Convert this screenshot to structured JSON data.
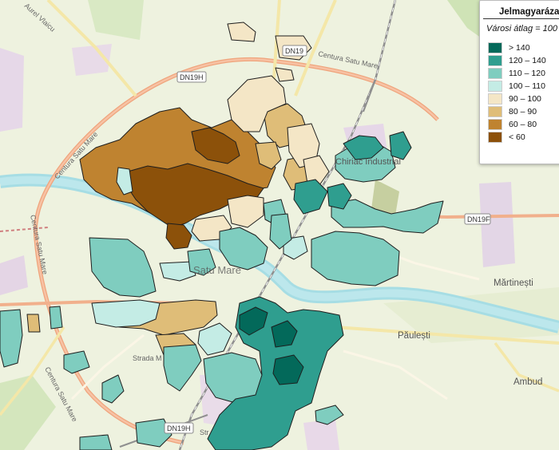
{
  "legend": {
    "title": "Jelmagyarázat",
    "subtitle": "Városi átlag = 100",
    "items": [
      {
        "label": "> 140",
        "color": "#03695a"
      },
      {
        "label": "120 – 140",
        "color": "#2f9e8f"
      },
      {
        "label": "110 – 120",
        "color": "#7fcdbf"
      },
      {
        "label": "100 – 110",
        "color": "#c4ece5"
      },
      {
        "label": "90 – 100",
        "color": "#f4e6c6"
      },
      {
        "label": "80 – 90",
        "color": "#dfbd78"
      },
      {
        "label": "60 – 80",
        "color": "#bf8330"
      },
      {
        "label": "< 60",
        "color": "#8c510a"
      }
    ]
  },
  "places": {
    "city": "Satu Mare",
    "chiriac": "Chiriac Industrial",
    "martinesti": "Mărtinești",
    "paulesti": "Păulești",
    "ambud": "Ambud"
  },
  "roads": {
    "centura_top": "Centura Satu Mare",
    "centura_left": "Centura Satu Mare",
    "centura_left2": "Centura Satu Mare",
    "centura_bottom": "Centura Satu Mare",
    "aurel_vlaicu": "Aurel Vlaicu",
    "strada": "Strada M",
    "dn19h_top": "DN19H",
    "dn19h_bottom": "DN19H",
    "dn19f": "DN19F",
    "dn19": "DN19",
    "str": "Str"
  }
}
